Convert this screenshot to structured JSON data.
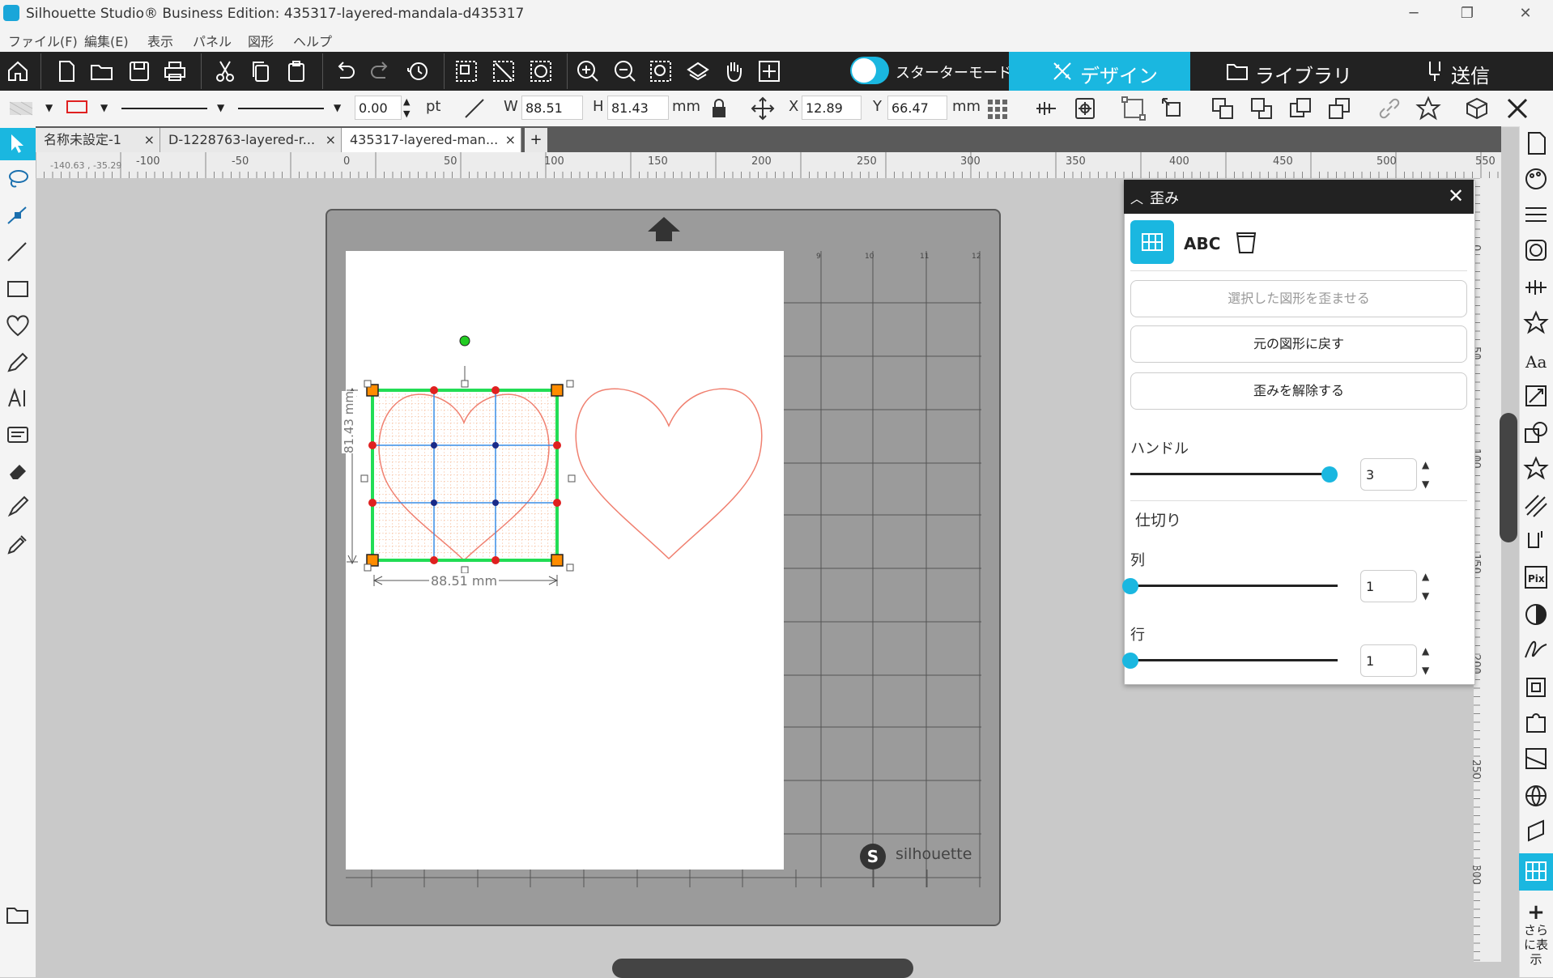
{
  "window": {
    "title": "Silhouette Studio® Business Edition: 435317-layered-mandala-d435317",
    "min": "─",
    "max": "❐",
    "close": "✕"
  },
  "menu": [
    "ファイル(F)",
    "編集(E)",
    "表示",
    "パネル",
    "図形",
    "ヘルプ"
  ],
  "toolbar": {
    "starter_mode_label": "スターターモードオフ",
    "tabs": [
      {
        "label": "デザイン",
        "icon": "design-icon"
      },
      {
        "label": "ライブラリ",
        "icon": "folder-icon"
      },
      {
        "label": "送信",
        "icon": "send-icon"
      }
    ]
  },
  "properties": {
    "line_width": "0.00",
    "line_unit": "pt",
    "w_label": "W",
    "w_value": "88.51",
    "h_label": "H",
    "h_value": "81.43",
    "size_unit": "mm",
    "x_label": "X",
    "x_value": "12.89",
    "y_label": "Y",
    "y_value": "66.47",
    "pos_unit": "mm",
    "line_color": "#e02020"
  },
  "doc_tabs": [
    {
      "label": "名称未設定-1",
      "close": "×"
    },
    {
      "label": "D-1228763-layered-r...",
      "close": "×"
    },
    {
      "label": "435317-layered-man...",
      "close": "×",
      "active": true
    }
  ],
  "add_tab": "+",
  "ruler": {
    "coord_readout": "-140.63 , -35.29",
    "h_labels": [
      "-100",
      "-50",
      "0",
      "50",
      "100",
      "150",
      "200",
      "250",
      "300",
      "350",
      "400",
      "450",
      "500",
      "550"
    ],
    "v_labels": [
      "0",
      "50",
      "100",
      "150",
      "200",
      "250",
      "300"
    ]
  },
  "canvas": {
    "width_dim": "88.51 mm",
    "height_dim": "81.43 mm",
    "mat_brand": "silhouette",
    "mat_numbers": [
      "9",
      "10",
      "11",
      "12"
    ],
    "heart_color": "#f08070",
    "selection_color": "#22dd55",
    "grid_color": "#3a8ee6"
  },
  "warp_panel": {
    "title": "歪み",
    "close": "✕",
    "tab_icons": [
      "grid-warp-icon",
      "abc-warp-icon",
      "cup-warp-icon"
    ],
    "apply_button": "選択した図形を歪ませる",
    "revert_button": "元の図形に戻す",
    "release_button": "歪みを解除する",
    "handle_label": "ハンドル",
    "handle_value": "3",
    "handle_level": 1.0,
    "divider_label": "仕切り",
    "columns_label": "列",
    "columns_value": "1",
    "columns_level": 0.0,
    "rows_label": "行",
    "rows_value": "1",
    "rows_level": 0.0,
    "accent": "#1ab7e0"
  },
  "right_panel": {
    "more_label": "さらに表示",
    "more_plus": "+"
  }
}
